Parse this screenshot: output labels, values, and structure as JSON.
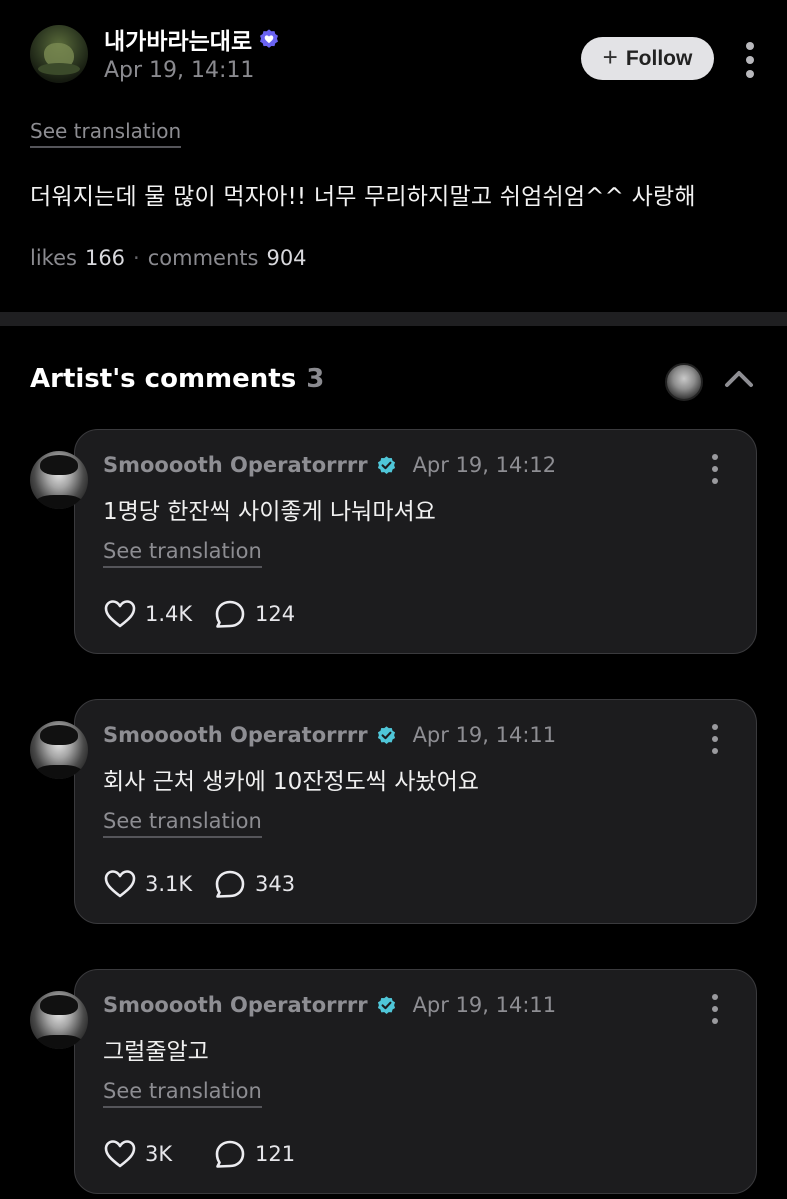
{
  "post": {
    "author": "내가바라는대로",
    "date": "Apr 19, 14:11",
    "follow_label": "Follow",
    "see_translation": "See translation",
    "body": "더워지는데 물 많이 먹자아!! 너무 무리하지말고 쉬엄쉬엄^^ 사랑해",
    "likes_label": "likes",
    "likes_count": "166",
    "comments_label": "comments",
    "comments_count": "904"
  },
  "artist_comments": {
    "title": "Artist's comments",
    "count": "3"
  },
  "comments": [
    {
      "author": "Smooooth Operatorrrr",
      "date": "Apr 19, 14:12",
      "body": "1명당 한잔씩 사이좋게 나눠마셔요",
      "see_translation": "See translation",
      "likes": "1.4K",
      "replies": "124"
    },
    {
      "author": "Smooooth Operatorrrr",
      "date": "Apr 19, 14:11",
      "body": "회사 근처 생카에 10잔정도씩 사놨어요",
      "see_translation": "See translation",
      "likes": "3.1K",
      "replies": "343"
    },
    {
      "author": "Smooooth Operatorrrr",
      "date": "Apr 19, 14:11",
      "body": "그럴줄알고",
      "see_translation": "See translation",
      "likes": "3K",
      "replies": "121"
    }
  ],
  "colors": {
    "background": "#000000",
    "card": "#1c1c1e",
    "verified_blue": "#5b5bf0",
    "verified_teal": "#4fc6d8",
    "muted_text": "#8e8e93"
  }
}
